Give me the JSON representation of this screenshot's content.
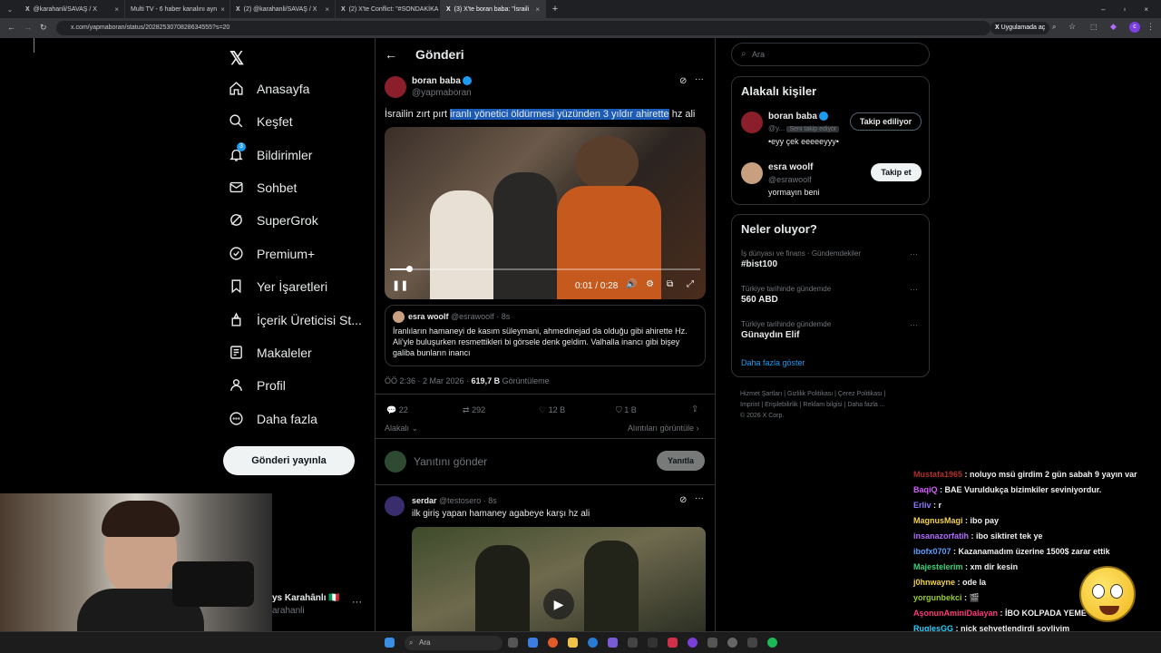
{
  "browser": {
    "tabs": [
      {
        "label": "@karahanli/SAVAŞ / X"
      },
      {
        "label": "Multi TV - 6 haber kanalını ayn"
      },
      {
        "label": "(2) @karahanli/SAVAŞ / X"
      },
      {
        "label": "(2) X'te Conflict: \"#SONDAKİKA"
      },
      {
        "label": "(3) X'te boran baba: \"İsraili"
      }
    ],
    "url": "x.com/yapmaboran/status/2028253070828634555?s=20",
    "extension_label": "Uygulamada aç"
  },
  "sidebar": {
    "items": [
      {
        "label": "Anasayfa",
        "icon": "home-icon"
      },
      {
        "label": "Keşfet",
        "icon": "search-icon"
      },
      {
        "label": "Bildirimler",
        "icon": "bell-icon",
        "badge": "3"
      },
      {
        "label": "Sohbet",
        "icon": "mail-icon"
      },
      {
        "label": "SuperGrok",
        "icon": "grok-icon"
      },
      {
        "label": "Premium+",
        "icon": "premium-icon"
      },
      {
        "label": "Yer İşaretleri",
        "icon": "bookmark-icon"
      },
      {
        "label": "İçerik Üreticisi St...",
        "icon": "creator-icon"
      },
      {
        "label": "Makaleler",
        "icon": "article-icon"
      },
      {
        "label": "Profil",
        "icon": "profile-icon"
      },
      {
        "label": "Daha fazla",
        "icon": "more-icon"
      }
    ],
    "post_button": "Gönderi yayınla",
    "account": {
      "name": "ys Karahânlı 🇮🇹",
      "handle": "arahanli"
    }
  },
  "header": {
    "title": "Gönderi"
  },
  "post": {
    "author": "boran baba",
    "handle": "@yapmaboran",
    "text_before": "İsrailin zırt pırt ",
    "text_highlight": "iranlı yönetici öldürmesi yüzünden 3 yıldır ahirette",
    "text_after": " hz ali",
    "video_time": "0:01 / 0:28",
    "video_progress": 0.06,
    "quote": {
      "author": "esra woolf",
      "handle": "@esrawoolf",
      "time": "8s",
      "text": "İranlıların hamaneyi de kasım süleymani, ahmedinejad da olduğu gibi ahirette Hz. Ali'yle buluşurken resmettikleri bi görsele denk geldim. Valhalla inancı gibi bişey galiba bunların inancı"
    },
    "meta_time": "ÖÖ 2:36 · 2 Mar 2026 · ",
    "views_count": "619,7 B",
    "views_label": " Görüntüleme",
    "actions": {
      "replies": "22",
      "reposts": "292",
      "likes": "12 B",
      "bookmarks": "1 B"
    },
    "related_label": "Alakalı",
    "quotes_label": "Alıntıları görüntüle"
  },
  "reply_box": {
    "placeholder": "Yanıtını gönder",
    "button": "Yanıtla"
  },
  "reply": {
    "author": "serdar",
    "handle": "@testosero",
    "time": "8s",
    "text": "ilk giriş yapan hamaney agabeye karşı hz ali"
  },
  "right": {
    "search_placeholder": "Ara",
    "related_title": "Alakalı kişiler",
    "people": [
      {
        "name": "boran baba",
        "handle": "@y...",
        "badge": "Seni takip ediyor",
        "bio": "•eyy çek eeeeeyyy•",
        "button": "Takip ediliyor"
      },
      {
        "name": "esra woolf",
        "handle": "@esrawoolf",
        "bio": "yormayın beni",
        "button": "Takip et"
      }
    ],
    "trends_title": "Neler oluyor?",
    "trends": [
      {
        "context": "İş dünyası ve finans · Gündemdekiler",
        "name": "#bist100"
      },
      {
        "context": "Türkiye tarihinde gündemde",
        "name": "560 ABD"
      },
      {
        "context": "Türkiye tarihinde gündemde",
        "name": "Günaydın Elif"
      }
    ],
    "show_more": "Daha fazla göster",
    "footer": [
      "Hizmet Şartları",
      "Gizlilik Politikası",
      "Çerez Politikası",
      "Imprint",
      "Erişilebilirlik",
      "Reklam bilgisi",
      "Daha fazla ...",
      "© 2026 X Corp."
    ]
  },
  "chat": [
    {
      "user": "Mustafa1965",
      "text": ": noluyo msü girdim 2 gün sabah 9 yayın var",
      "color": "#b0302a"
    },
    {
      "user": "BaqiQ",
      "text": ": BAE Vuruldukça bizimkiler seviniyordur.",
      "color": "#d85aff"
    },
    {
      "user": "Erliv",
      "text": ": r",
      "color": "#8a7aff"
    },
    {
      "user": "MagnusMagi",
      "text": ": ibo pay",
      "color": "#f3d24a"
    },
    {
      "user": "insanazorfatih",
      "text": ": ibo siktiret tek ye",
      "color": "#b36bff"
    },
    {
      "user": "ibofx0707",
      "text": ": Kazanamadım üzerine 1500$ zarar ettik",
      "color": "#5aa0ff"
    },
    {
      "user": "Majestelerim",
      "text": ": xm dir kesin",
      "color": "#3ad17a"
    },
    {
      "user": "j0hnwayne",
      "text": ": ode la",
      "color": "#f3d24a"
    },
    {
      "user": "yorgunbekci",
      "text": ": 🎬",
      "color": "#9acd32"
    },
    {
      "user": "AşonunAminiDalayan",
      "text": ": İBO KOLPADA YEME BİZİ İBO",
      "color": "#ff3a7a"
    },
    {
      "user": "RuglesGG",
      "text": ": nick sehvetlendirdi soyliyim",
      "color": "#2ad2ff"
    }
  ],
  "taskbar": {
    "search_placeholder": "Ara"
  },
  "colors": {
    "accent": "#1d9bf0",
    "highlight": "#1c5cb6",
    "background": "#000000"
  }
}
